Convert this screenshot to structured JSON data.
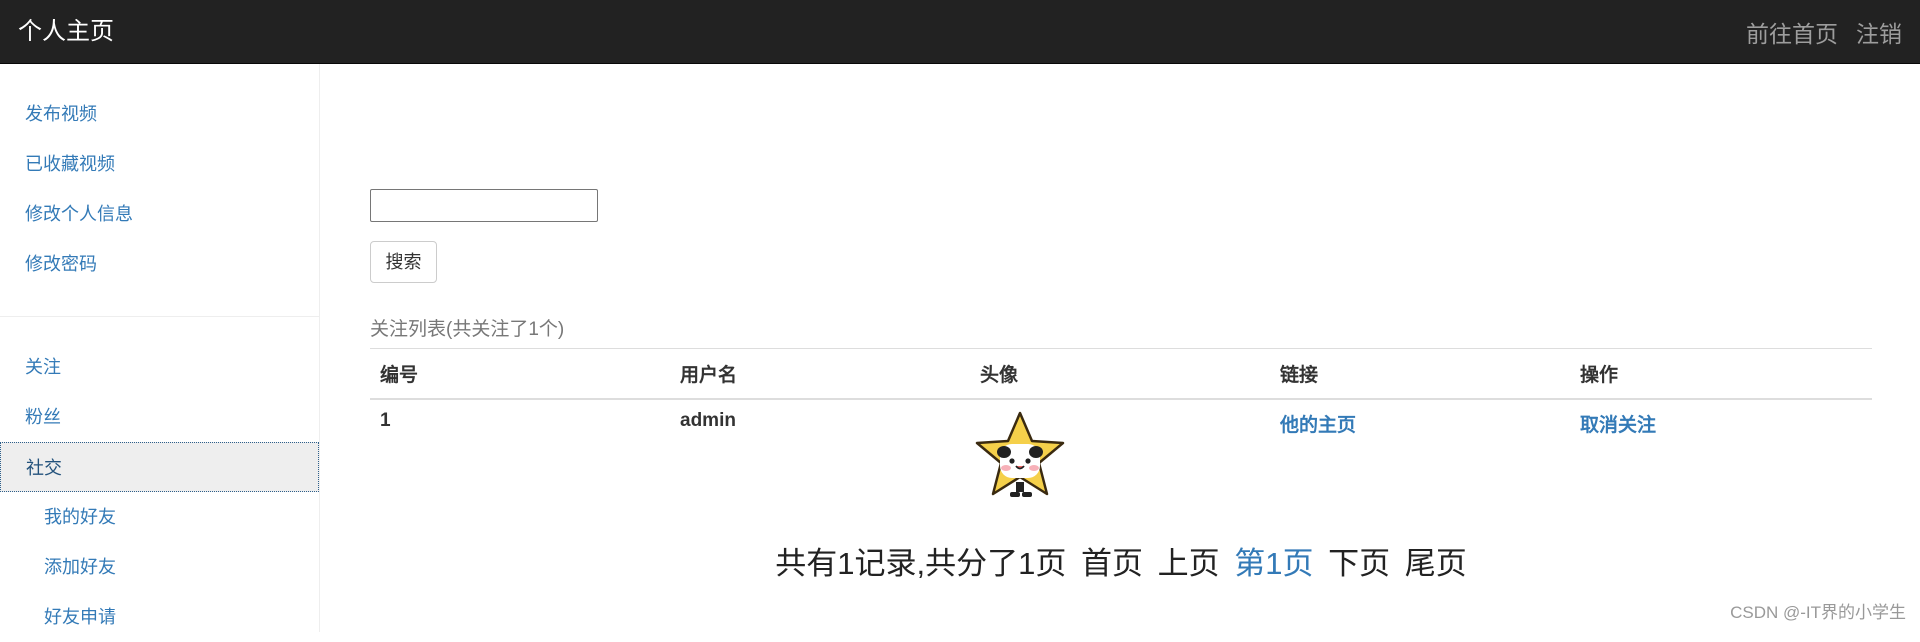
{
  "navbar": {
    "brand": "个人主页",
    "links": [
      "前往首页",
      "注销"
    ]
  },
  "sidebar": {
    "group1": [
      "发布视频",
      "已收藏视频",
      "修改个人信息",
      "修改密码"
    ],
    "group2": [
      "关注",
      "粉丝",
      "社交"
    ],
    "subitems": [
      "我的好友",
      "添加好友",
      "好友申请"
    ]
  },
  "search": {
    "input_value": "",
    "button_label": "搜索"
  },
  "list": {
    "caption": "关注列表(共关注了1个)",
    "headers": [
      "编号",
      "用户名",
      "头像",
      "链接",
      "操作"
    ],
    "rows": [
      {
        "id": "1",
        "username": "admin",
        "link": "他的主页",
        "action": "取消关注"
      }
    ]
  },
  "pager": {
    "summary": "共有1记录,共分了1页",
    "first": "首页",
    "prev": "上页",
    "current": "第1页",
    "next": "下页",
    "last": "尾页"
  },
  "watermark": "CSDN @-IT界的小学生",
  "colors": {
    "navbar_bg": "#222222",
    "link_blue": "#337ab7",
    "avatar_star": "#f5d04a"
  }
}
